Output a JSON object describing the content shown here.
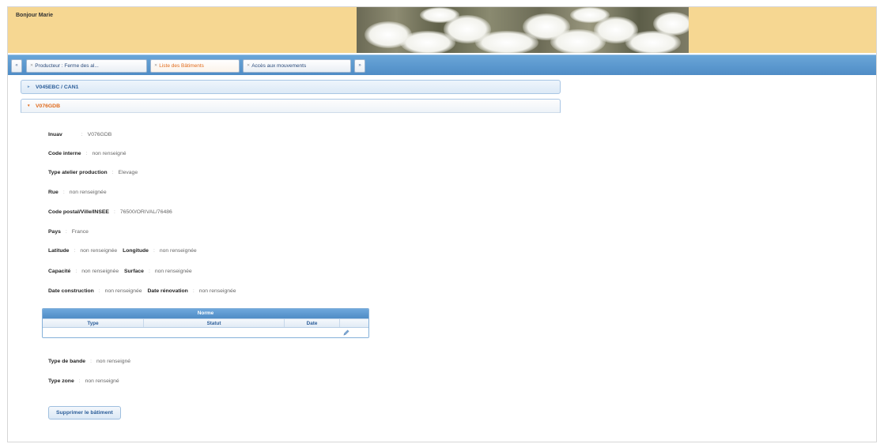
{
  "header": {
    "greeting": "Bonjour Marie"
  },
  "tabs": {
    "left_arrow": "«",
    "items": [
      {
        "label": "Producteur : Ferme des al..."
      },
      {
        "label": "Liste des Bâtiments",
        "active": true
      },
      {
        "label": "Accès aux mouvements"
      }
    ],
    "right_arrow": "»"
  },
  "accordion": {
    "collapsed_item": "V045EBC / CAN1",
    "open_item": "V076GDB"
  },
  "details": {
    "inuav": {
      "label": "Inuav",
      "value": "V076GDB"
    },
    "code_interne": {
      "label": "Code interne",
      "value": "non renseigné"
    },
    "type_atelier": {
      "label": "Type atelier production",
      "value": "Elevage"
    },
    "rue": {
      "label": "Rue",
      "value": "non renseignée"
    },
    "code_postal": {
      "label": "Code postal/Ville/INSEE",
      "value": "76500/ORIVAL/76486"
    },
    "pays": {
      "label": "Pays",
      "value": "France"
    },
    "latitude": {
      "label": "Latitude",
      "value": "non renseignée"
    },
    "longitude": {
      "label": "Longitude",
      "value": "non renseignée"
    },
    "capacite": {
      "label": "Capacité",
      "value": "non renseignée"
    },
    "surface": {
      "label": "Surface",
      "value": "non renseignée"
    },
    "date_construction": {
      "label": "Date construction",
      "value": "non renseignée"
    },
    "date_renovation": {
      "label": "Date rénovation",
      "value": "non renseignée"
    },
    "type_bande": {
      "label": "Type de bande",
      "value": "non renseigné"
    },
    "type_zone": {
      "label": "Type zone",
      "value": "non renseigné"
    }
  },
  "norme_table": {
    "title": "Norme",
    "columns": [
      "Type",
      "Statut",
      "Date"
    ]
  },
  "actions": {
    "delete_label": "Supprimer le bâtiment"
  },
  "colors": {
    "header_bg": "#f6d792",
    "tabbar_blue": "#4f8cc6",
    "active_tab_text": "#e06b1c",
    "link_blue": "#2b5d99"
  },
  "icons": {
    "tab_close": "close-icon",
    "accordion_collapsed": "chevron-right-icon",
    "accordion_open": "chevron-down-icon",
    "edit": "pencil-icon"
  }
}
